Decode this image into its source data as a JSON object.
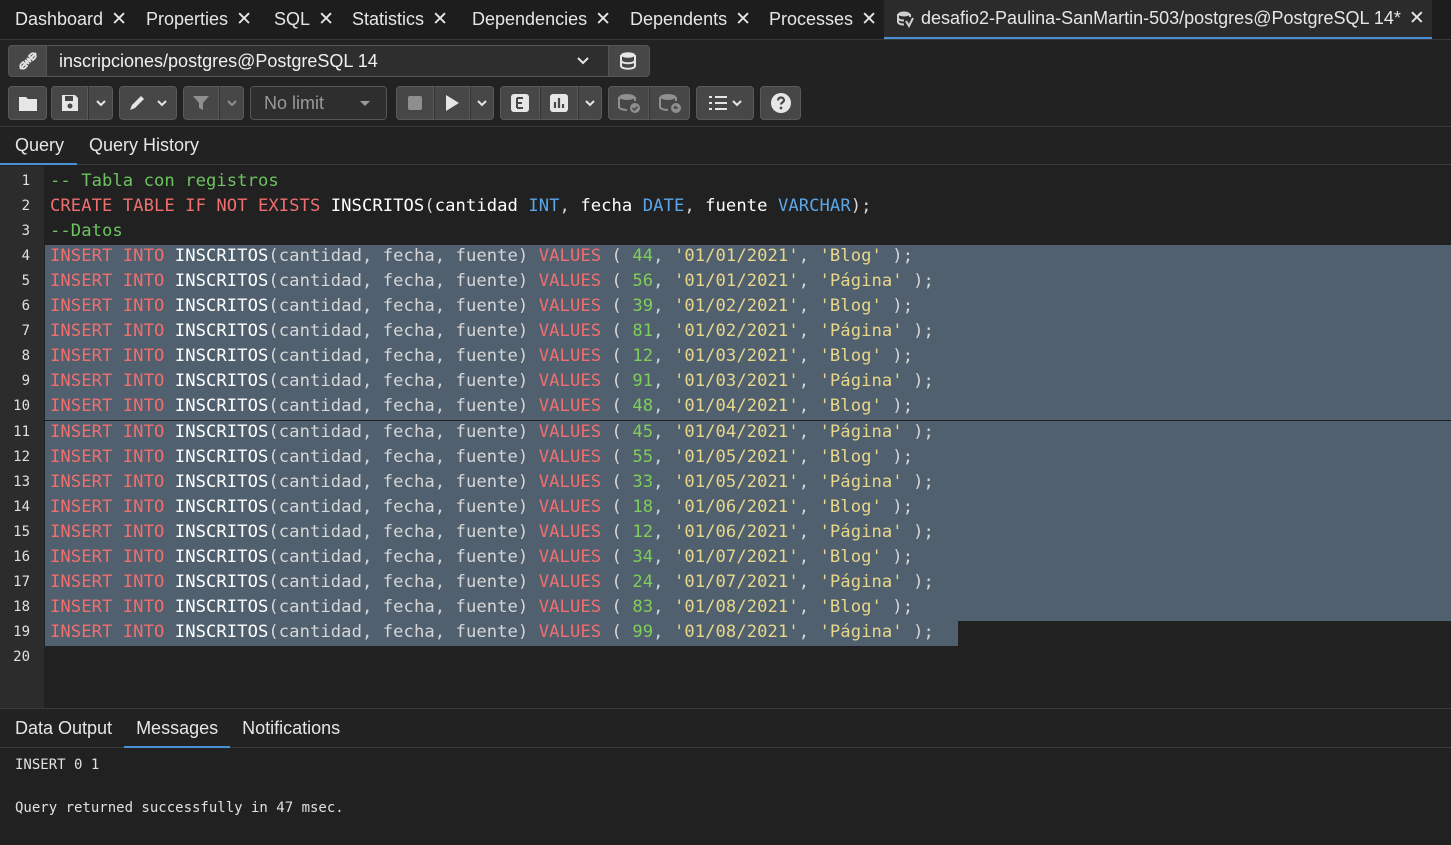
{
  "top_tabs": [
    {
      "label": "Dashboard"
    },
    {
      "label": "Properties"
    },
    {
      "label": "SQL"
    },
    {
      "label": "Statistics"
    },
    {
      "label": "Dependencies"
    },
    {
      "label": "Dependents"
    },
    {
      "label": "Processes"
    },
    {
      "label": "desafio2-Paulina-SanMartin-503/postgres@PostgreSQL 14*"
    }
  ],
  "connection": {
    "value": "inscripciones/postgres@PostgreSQL 14"
  },
  "toolbar": {
    "limit_label": "No limit"
  },
  "query_tabs": [
    {
      "label": "Query"
    },
    {
      "label": "Query History"
    }
  ],
  "editor": {
    "line_numbers": [
      "1",
      "2",
      "3",
      "4",
      "5",
      "6",
      "7",
      "8",
      "9",
      "10",
      "11",
      "12",
      "13",
      "14",
      "15",
      "16",
      "17",
      "18",
      "19",
      "20"
    ],
    "comment1": "-- Tabla con registros",
    "create": {
      "kw1": "CREATE TABLE IF NOT EXISTS",
      "table": "INSCRITOS",
      "p_open": "(",
      "col1": "cantidad",
      "t1": "INT",
      "col2": "fecha",
      "t2": "DATE",
      "col3": "fuente",
      "t3": "VARCHAR",
      "p_close": ");"
    },
    "comment2": "--Datos",
    "insert_prefix": {
      "kw": "INSERT INTO",
      "table": "INSCRITOS",
      "cols": "(cantidad, fecha, fuente)",
      "values_kw": "VALUES"
    },
    "rows": [
      {
        "cantidad": "44",
        "fecha": "'01/01/2021'",
        "fuente": "'Blog'"
      },
      {
        "cantidad": "56",
        "fecha": "'01/01/2021'",
        "fuente": "'Página'"
      },
      {
        "cantidad": "39",
        "fecha": "'01/02/2021'",
        "fuente": "'Blog'"
      },
      {
        "cantidad": "81",
        "fecha": "'01/02/2021'",
        "fuente": "'Página'"
      },
      {
        "cantidad": "12",
        "fecha": "'01/03/2021'",
        "fuente": "'Blog'"
      },
      {
        "cantidad": "91",
        "fecha": "'01/03/2021'",
        "fuente": "'Página'"
      },
      {
        "cantidad": "48",
        "fecha": "'01/04/2021'",
        "fuente": "'Blog'"
      },
      {
        "cantidad": "45",
        "fecha": "'01/04/2021'",
        "fuente": "'Página'"
      },
      {
        "cantidad": "55",
        "fecha": "'01/05/2021'",
        "fuente": "'Blog'"
      },
      {
        "cantidad": "33",
        "fecha": "'01/05/2021'",
        "fuente": "'Página'"
      },
      {
        "cantidad": "18",
        "fecha": "'01/06/2021'",
        "fuente": "'Blog'"
      },
      {
        "cantidad": "12",
        "fecha": "'01/06/2021'",
        "fuente": "'Página'"
      },
      {
        "cantidad": "34",
        "fecha": "'01/07/2021'",
        "fuente": "'Blog'"
      },
      {
        "cantidad": "24",
        "fecha": "'01/07/2021'",
        "fuente": "'Página'"
      },
      {
        "cantidad": "83",
        "fecha": "'01/08/2021'",
        "fuente": "'Blog'"
      },
      {
        "cantidad": "99",
        "fecha": "'01/08/2021'",
        "fuente": "'Página'"
      }
    ]
  },
  "output_tabs": [
    {
      "label": "Data Output"
    },
    {
      "label": "Messages"
    },
    {
      "label": "Notifications"
    }
  ],
  "messages": {
    "line1": "INSERT 0 1",
    "line2": "Query returned successfully in 47 msec."
  },
  "colors": {
    "selection": "#50606f",
    "keyword": "#ef6f6f",
    "type": "#5aa6e8",
    "number": "#7fce5a",
    "string": "#e8d78a",
    "comment": "#6cc35f",
    "accent": "#4a90d9"
  }
}
